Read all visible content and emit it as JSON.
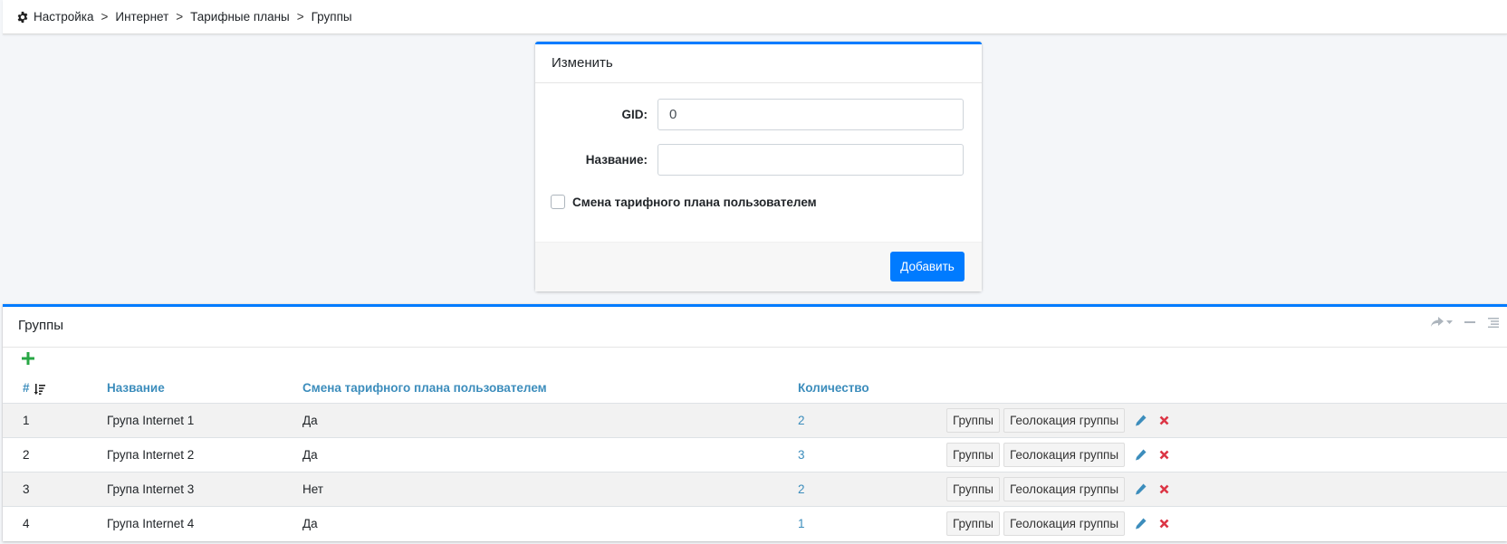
{
  "breadcrumb": {
    "icon": "gear-icon",
    "items": [
      "Настройка",
      "Интернет",
      "Тарифные планы",
      "Группы"
    ],
    "separator": ">"
  },
  "edit_form": {
    "title": "Изменить",
    "gid_label": "GID:",
    "gid_value": "0",
    "name_label": "Название:",
    "name_value": "",
    "checkbox_label": "Смена тарифного плана пользователем",
    "checkbox_checked": false,
    "submit_label": "Добавить"
  },
  "groups": {
    "title": "Группы",
    "columns": [
      "#",
      "Название",
      "Смена тарифного плана пользователем",
      "Количество"
    ],
    "rows": [
      {
        "id": "1",
        "name": "Група Internet 1",
        "change": "Да",
        "count": "2"
      },
      {
        "id": "2",
        "name": "Група Internet 2",
        "change": "Да",
        "count": "3"
      },
      {
        "id": "3",
        "name": "Група Internet 3",
        "change": "Нет",
        "count": "2"
      },
      {
        "id": "4",
        "name": "Група Internet 4",
        "change": "Да",
        "count": "1"
      }
    ],
    "row_actions": {
      "groups_button": "Группы",
      "geo_button": "Геолокация группы"
    }
  },
  "colors": {
    "primary": "#007bff",
    "link": "#3c8dbc",
    "add": "#28a745",
    "delete": "#dc3545"
  }
}
